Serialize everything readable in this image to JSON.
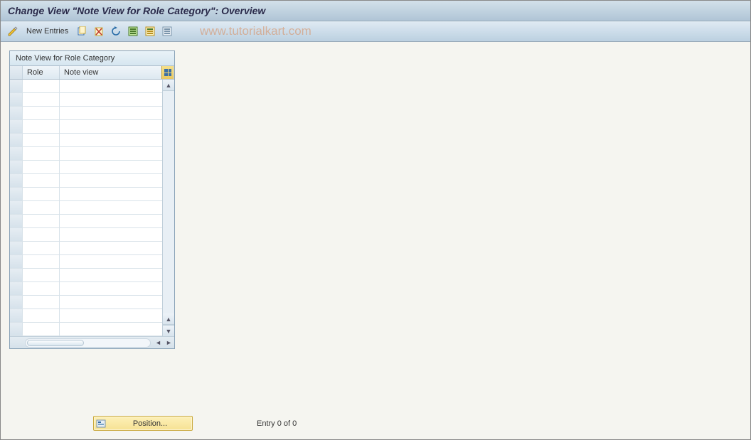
{
  "title": "Change View \"Note View for Role Category\": Overview",
  "toolbar": {
    "new_entries_label": "New Entries"
  },
  "watermark": "www.tutorialkart.com",
  "table": {
    "title": "Note View for Role Category",
    "columns": {
      "role": "Role",
      "noteview": "Note view"
    },
    "row_count": 19
  },
  "footer": {
    "position_label": "Position...",
    "entry_text": "Entry 0 of 0"
  }
}
